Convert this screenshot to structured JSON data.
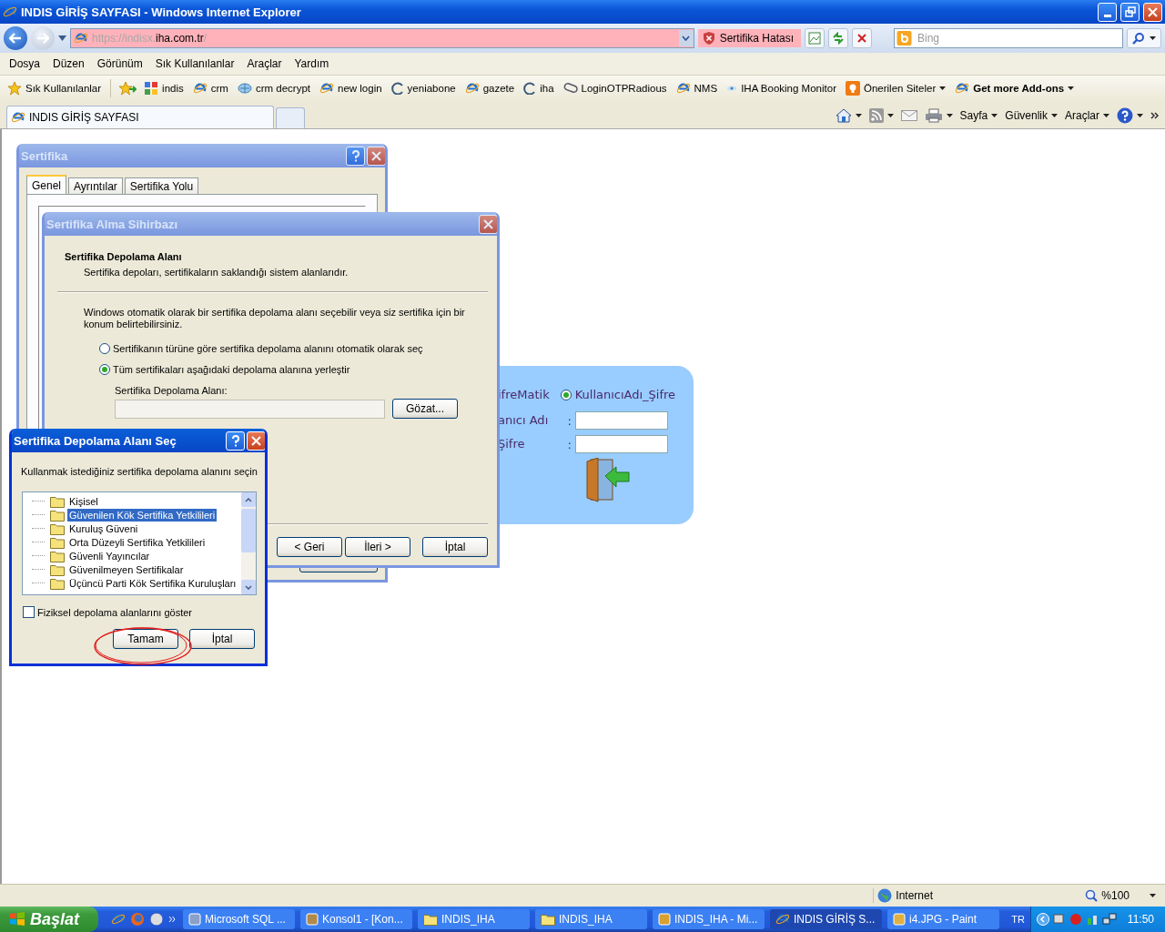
{
  "window": {
    "title": "INDIS GİRİŞ SAYFASI - Windows Internet Explorer"
  },
  "address_bar": {
    "prefix": "https://indisx.",
    "domain": "iha.com.tr",
    "suffix": "/",
    "cert_error": "Sertifika Hatası"
  },
  "search": {
    "placeholder": "Bing"
  },
  "menu": [
    "Dosya",
    "Düzen",
    "Görünüm",
    "Sık Kullanılanlar",
    "Araçlar",
    "Yardım"
  ],
  "favorites": {
    "label": "Sık Kullanılanlar",
    "items": [
      {
        "label": "indis",
        "kind": "google",
        "dropdown": false
      },
      {
        "label": "crm",
        "kind": "ie",
        "dropdown": false
      },
      {
        "label": "crm decrypt",
        "kind": "crm",
        "dropdown": false
      },
      {
        "label": "new login",
        "kind": "ie",
        "dropdown": false
      },
      {
        "label": "yeniabone",
        "kind": "arc",
        "dropdown": false
      },
      {
        "label": "gazete",
        "kind": "ie",
        "dropdown": false
      },
      {
        "label": "iha",
        "kind": "arc",
        "dropdown": false
      },
      {
        "label": "LoginOTPRadious",
        "kind": "tag",
        "dropdown": false
      },
      {
        "label": "NMS",
        "kind": "ie",
        "dropdown": false
      },
      {
        "label": "IHA Booking Monitor",
        "kind": "eye",
        "dropdown": false
      },
      {
        "label": "Önerilen Siteler",
        "kind": "bulb",
        "dropdown": true
      },
      {
        "label": "Get more Add-ons",
        "kind": "addons",
        "dropdown": true
      }
    ]
  },
  "tabs": [
    {
      "label": "INDIS GİRİŞ SAYFASI",
      "selected": true
    }
  ],
  "command_bar": [
    {
      "kind": "home"
    },
    {
      "kind": "feed"
    },
    {
      "kind": "mail"
    },
    {
      "kind": "print"
    },
    {
      "kind": "menu",
      "label": "Sayfa"
    },
    {
      "kind": "menu",
      "label": "Güvenlik"
    },
    {
      "kind": "menu",
      "label": "Araçlar"
    },
    {
      "kind": "help"
    }
  ],
  "login": {
    "method_label": "ifreMatik",
    "option": {
      "label": "KullanıcıAdı_Şifre",
      "selected": true
    },
    "fields": [
      {
        "label": "anıcı Adı",
        "colon": ":"
      },
      {
        "label": "Şifre",
        "colon": ":"
      }
    ]
  },
  "certificate_dialog": {
    "title": "Sertifika",
    "tabs": [
      {
        "label": "Genel",
        "selected": true
      },
      {
        "label": "Ayrıntılar",
        "selected": false
      },
      {
        "label": "Sertifika Yolu",
        "selected": false
      }
    ]
  },
  "wizard": {
    "title": "Sertifika Alma Sihirbazı",
    "heading": "Sertifika Depolama Alanı",
    "subheading": "Sertifika depoları, sertifikaların saklandığı sistem alanlarıdır.",
    "description": "Windows otomatik olarak bir sertifika depolama alanı seçebilir veya siz sertifika için bir konum belirtebilirsiniz.",
    "options": [
      {
        "label": "Sertifikanın türüne göre sertifika depolama alanını otomatik olarak seç",
        "selected": false
      },
      {
        "label": "Tüm sertifikaları aşağıdaki depolama alanına yerleştir",
        "selected": true
      }
    ],
    "store_label": "Sertifika Depolama Alanı:",
    "browse_button": "Gözat...",
    "buttons": [
      "< Geri",
      "İleri >",
      "İptal"
    ]
  },
  "store_dialog": {
    "title": "Sertifika Depolama Alanı Seç",
    "prompt": "Kullanmak istediğiniz sertifika depolama alanını seçin",
    "stores": [
      {
        "label": "Kişisel",
        "selected": false
      },
      {
        "label": "Güvenilen Kök Sertifika Yetkilileri",
        "selected": true
      },
      {
        "label": "Kuruluş Güveni",
        "selected": false
      },
      {
        "label": "Orta Düzeyli Sertifika Yetkilileri",
        "selected": false
      },
      {
        "label": "Güvenli Yayıncılar",
        "selected": false
      },
      {
        "label": "Güvenilmeyen Sertifikalar",
        "selected": false
      },
      {
        "label": "Üçüncü Parti Kök Sertifika Kuruluşları",
        "selected": false
      }
    ],
    "show_physical": {
      "label": "Fiziksel depolama alanlarını göster",
      "checked": false
    },
    "buttons": [
      "Tamam",
      "İptal"
    ]
  },
  "status_bar": {
    "zone": "Internet",
    "zoom": "%100"
  },
  "taskbar": {
    "start": "Başlat",
    "items": [
      {
        "label": "Microsoft SQL ...",
        "kind": "tool",
        "selected": false
      },
      {
        "label": "Konsol1 - [Kon...",
        "kind": "console",
        "selected": false
      },
      {
        "label": "INDIS_IHA",
        "kind": "folder",
        "selected": false
      },
      {
        "label": "INDIS_IHA",
        "kind": "folder",
        "selected": false
      },
      {
        "label": "INDIS_IHA - Mi...",
        "kind": "mail",
        "selected": false
      },
      {
        "label": "INDIS GİRİŞ S...",
        "kind": "ie",
        "selected": true
      },
      {
        "label": "i4.JPG - Paint",
        "kind": "paint",
        "selected": false
      }
    ],
    "language": "TR",
    "clock": "11:50"
  }
}
